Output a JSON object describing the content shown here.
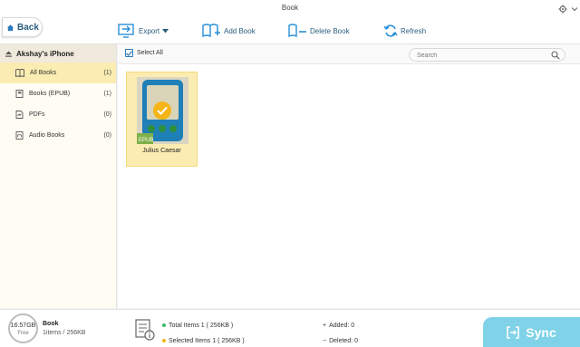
{
  "window": {
    "title": "Book"
  },
  "toolbar": {
    "back_label": "Back",
    "export_label": "Export",
    "add_label": "Add Book",
    "delete_label": "Delete Book",
    "refresh_label": "Refresh"
  },
  "sidebar": {
    "device_name": "Akshay's iPhone",
    "items": [
      {
        "label": "All Books",
        "count": "(1)",
        "icon": "book-open-icon"
      },
      {
        "label": "Books (EPUB)",
        "count": "(1)",
        "icon": "book-icon"
      },
      {
        "label": "PDFs",
        "count": "(0)",
        "icon": "pdf-icon"
      },
      {
        "label": "Audio Books",
        "count": "(0)",
        "icon": "headphones-icon"
      }
    ]
  },
  "main": {
    "select_all_label": "Select All",
    "search_placeholder": "Search",
    "books": [
      {
        "title": "Julius Caesar",
        "badge": "EPUB"
      }
    ]
  },
  "footer": {
    "storage_free": "16.57GB",
    "storage_free_label": "Free",
    "category_name": "Book",
    "category_summary": "1items / 256KB",
    "total_items": "Total Items 1 ( 256KB )",
    "selected_items": "Selected Items 1 ( 256KB )",
    "added": "Added: 0",
    "deleted": "Deleted: 0",
    "sync_label": "Sync"
  },
  "colors": {
    "accent_blue": "#2a5d7e",
    "selected_yellow": "#fbecb2",
    "sync_cyan": "#7fd2e8",
    "check_orange": "#f5b517",
    "total_dot": "#3dbb6e",
    "selected_dot": "#f5b517"
  }
}
